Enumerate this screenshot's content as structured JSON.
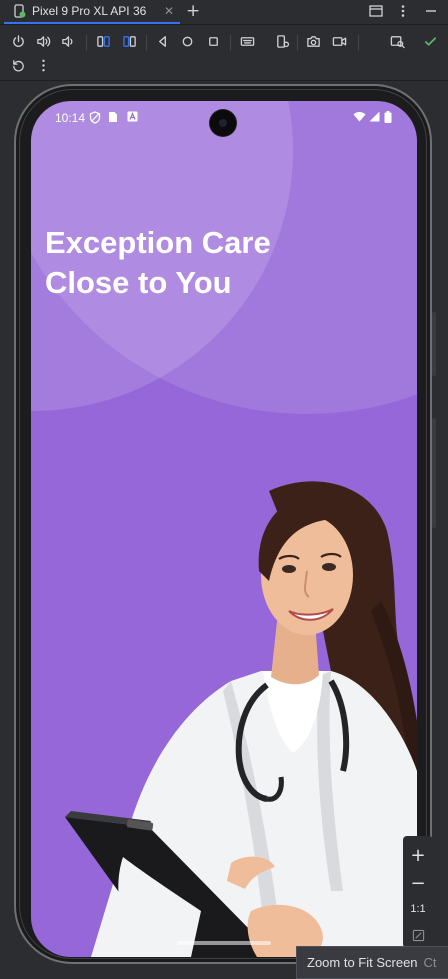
{
  "window": {
    "tab_title": "Pixel 9 Pro XL API 36",
    "tab_close": "✕",
    "add_tab": "+"
  },
  "toolbar": {
    "items": [
      "power-icon",
      "volume-up-icon",
      "volume-down-icon",
      "rotate-left-icon",
      "rotate-right-icon",
      "back-icon",
      "home-icon",
      "overview-icon",
      "keyboard-icon",
      "device-settings-icon",
      "screenshot-icon",
      "screen-record-icon",
      "display-mode-icon",
      "check-icon",
      "reset-icon",
      "more-icon"
    ]
  },
  "device": {
    "status_time": "10:14",
    "app": {
      "headline_line1": "Exception Care",
      "headline_line2": "Close to You",
      "background_color": "#9567d8"
    }
  },
  "zoom": {
    "zoom_in": "+",
    "zoom_out": "−",
    "actual_size": "1:1",
    "tooltip": "Zoom to Fit Screen",
    "tooltip_shortcut": "Ct"
  },
  "colors": {
    "accent": "#3574f0",
    "check": "#5fb865",
    "ide_background": "#2b2d30"
  }
}
